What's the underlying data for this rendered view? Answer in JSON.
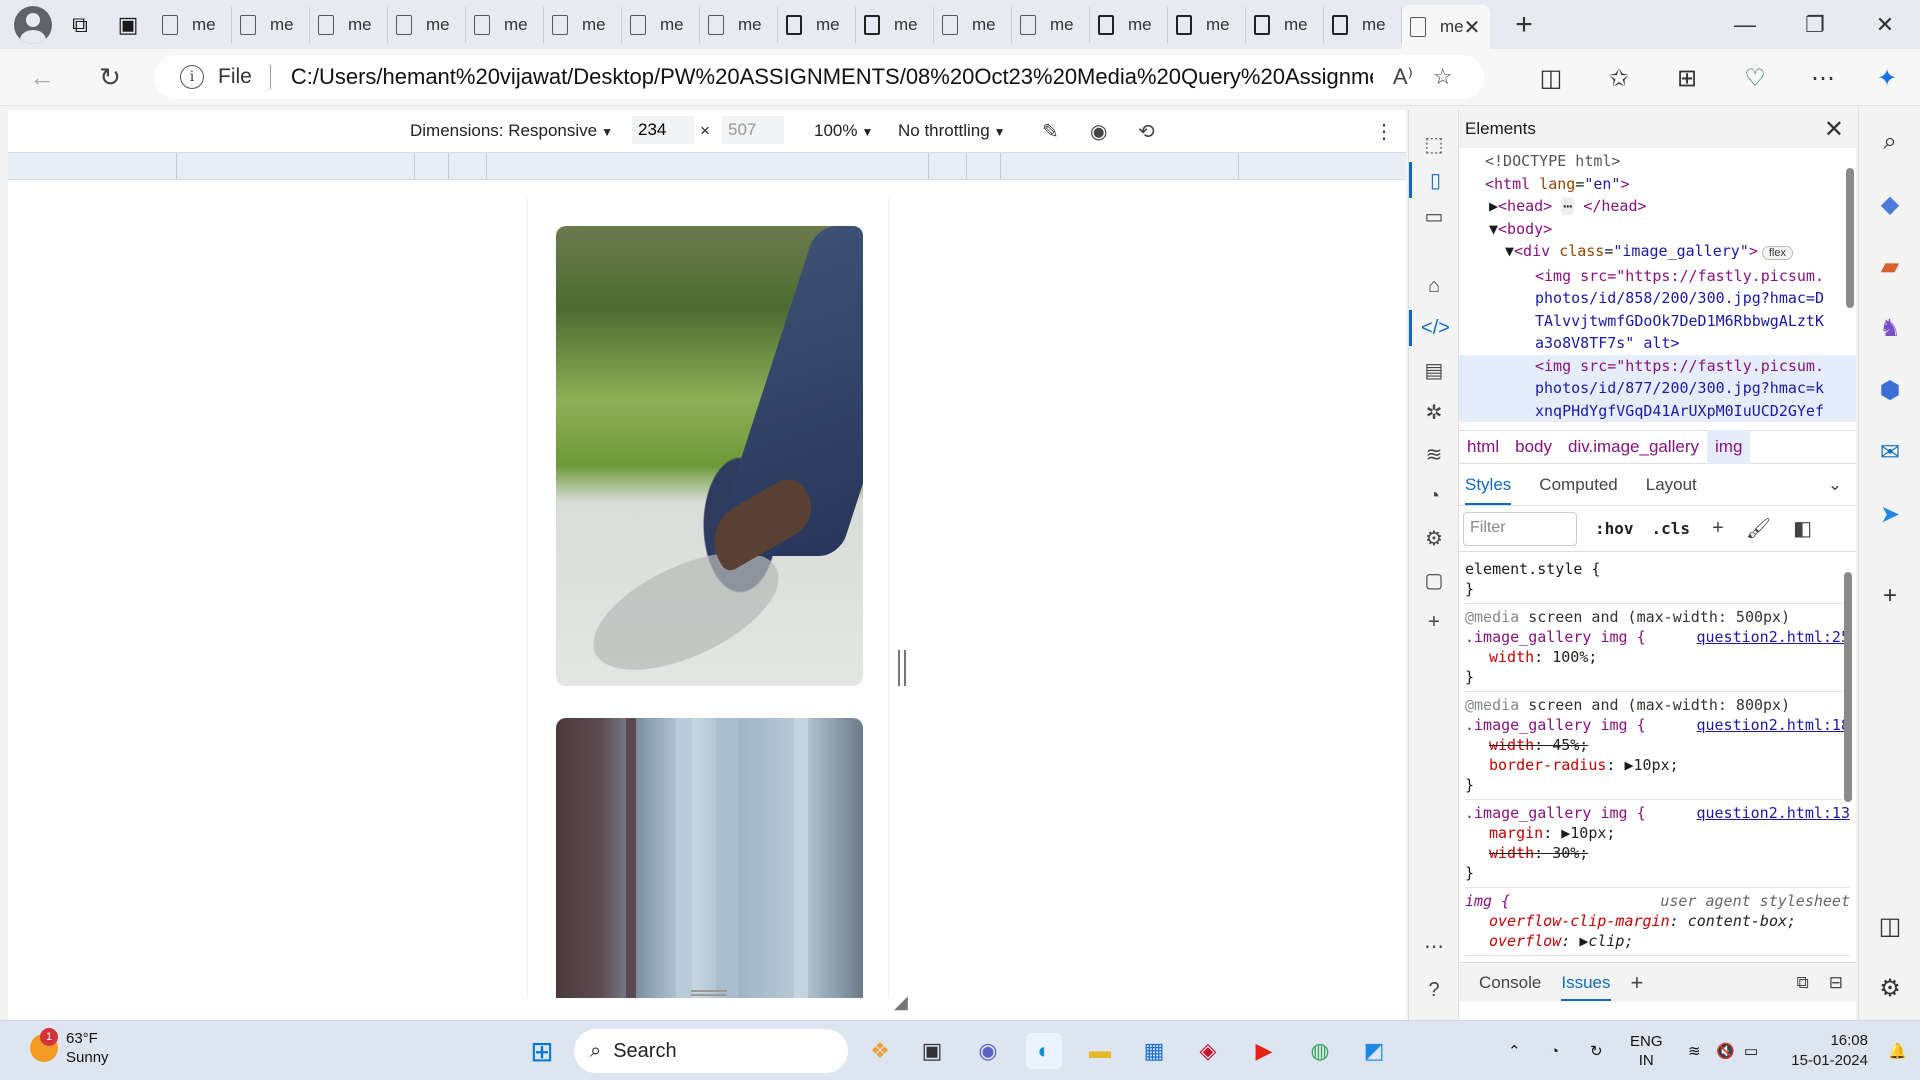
{
  "browser": {
    "tab_title": "me",
    "tab_count": 17,
    "address": {
      "scheme_label": "File",
      "url": "C:/Users/hemant%20vijawat/Desktop/PW%20ASSIGNMENTS/08%20Oct23%20Media%20Query%20Assignment/..."
    }
  },
  "device_toolbar": {
    "dimensions_label": "Dimensions: Responsive",
    "width": "234",
    "height": "507",
    "times": "×",
    "zoom": "100%",
    "throttling": "No throttling"
  },
  "devtools": {
    "panel_title": "Elements",
    "dom": {
      "doctype": "<!DOCTYPE html>",
      "html_open": "<html",
      "html_attr": "lang",
      "html_val": "\"en\"",
      "head": "<head>",
      "head_close": "</head>",
      "body": "<body>",
      "div_open": "<div",
      "div_attr": "class",
      "div_val": "\"image_gallery\"",
      "flex_badge": "flex",
      "img1_line1": "<img src=\"https://fastly.picsum.",
      "img1_line2": "photos/id/858/200/300.jpg?hmac=D",
      "img1_line3": "TAlvvjtwmfGDoOk7DeD1M6RbbwgALztK",
      "img1_line4": "a3o8V8TF7s\" alt>",
      "img2_line1": "<img src=\"https://fastly.picsum.",
      "img2_line2": "photos/id/877/200/300.jpg?hmac=k",
      "img2_line3": "xnqPHdYgfVGqD41ArUXpM0IuUCD2GYef"
    },
    "breadcrumbs": [
      "html",
      "body",
      "div.image_gallery",
      "img"
    ],
    "style_tabs": [
      "Styles",
      "Computed",
      "Layout"
    ],
    "filter_placeholder": "Filter",
    "hov": ":hov",
    "cls": ".cls",
    "rules": {
      "element_style": "element.style {",
      "close": "}",
      "media1_at": "@media",
      "media1": "screen and (max-width: 500px)",
      "sel1": ".image_gallery img {",
      "src1": "question2.html:25",
      "r1_p1_name": "width",
      "r1_p1_val": "100%;",
      "media2_at": "@media",
      "media2": "screen and (max-width: 800px)",
      "sel2": ".image_gallery img {",
      "src2": "question2.html:18",
      "r2_p1_name": "width",
      "r2_p1_val": "45%;",
      "r2_p2_name": "border-radius",
      "r2_p2_val": "10px;",
      "sel3": ".image_gallery img {",
      "src3": "question2.html:13",
      "r3_p1_name": "margin",
      "r3_p1_val": "10px;",
      "r3_p2_name": "width",
      "r3_p2_val": "30%;",
      "sel4": "img {",
      "ua": "user agent stylesheet",
      "r4_p1_name": "overflow-clip-margin",
      "r4_p1_val": "content-box;",
      "r4_p2_name": "overflow",
      "r4_p2_val": "clip;"
    },
    "drawer_tabs": [
      "Console",
      "Issues"
    ]
  },
  "taskbar": {
    "weather_temp": "63°F",
    "weather_cond": "Sunny",
    "weather_badge": "1",
    "search_label": "Search",
    "lang1": "ENG",
    "lang2": "IN",
    "time": "16:08",
    "date": "15-01-2024"
  }
}
